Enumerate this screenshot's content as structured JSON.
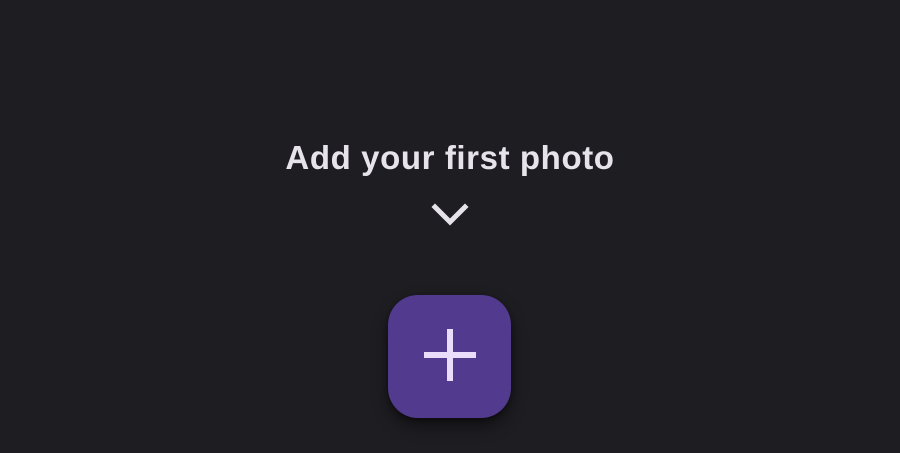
{
  "empty_state": {
    "prompt": "Add your first photo",
    "hint_icon": "chevron-down-icon"
  },
  "fab": {
    "icon": "plus-icon",
    "color": "#523a8f",
    "icon_color": "#eadcfb"
  },
  "colors": {
    "background": "#1e1d22",
    "text": "#e7e3ea"
  }
}
